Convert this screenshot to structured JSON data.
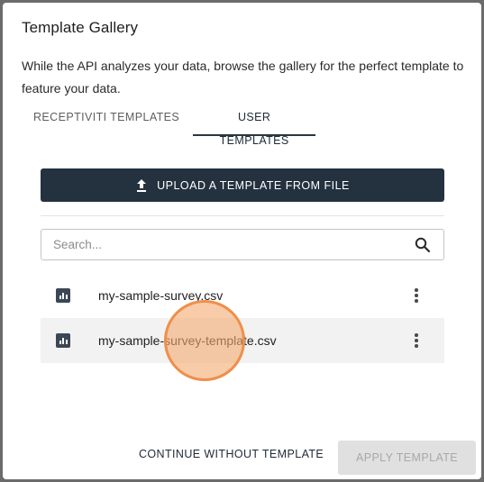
{
  "dialog": {
    "title": "Template Gallery",
    "description": "While the API analyzes your data, browse the gallery for the perfect template to feature your data."
  },
  "tabs": [
    {
      "label": "RECEPTIVITI TEMPLATES",
      "active": false
    },
    {
      "label": "USER TEMPLATES",
      "active": true
    }
  ],
  "upload": {
    "label": "UPLOAD A TEMPLATE FROM FILE",
    "icon": "upload-icon"
  },
  "search": {
    "placeholder": "Search...",
    "value": "",
    "icon": "search-icon"
  },
  "templates": [
    {
      "name": "my-sample-survey.csv",
      "icon": "bar-chart-icon",
      "selected": false
    },
    {
      "name": "my-sample-survey-template.csv",
      "icon": "bar-chart-icon",
      "selected": true
    }
  ],
  "footer": {
    "continue_label": "CONTINUE WITHOUT TEMPLATE",
    "apply_label": "APPLY TEMPLATE",
    "apply_disabled": true
  },
  "colors": {
    "primary": "#243240",
    "selected_row": "#f2f2f2",
    "disabled_button": "#e0e0e0",
    "cursor_highlight": "#ef8f4a"
  }
}
